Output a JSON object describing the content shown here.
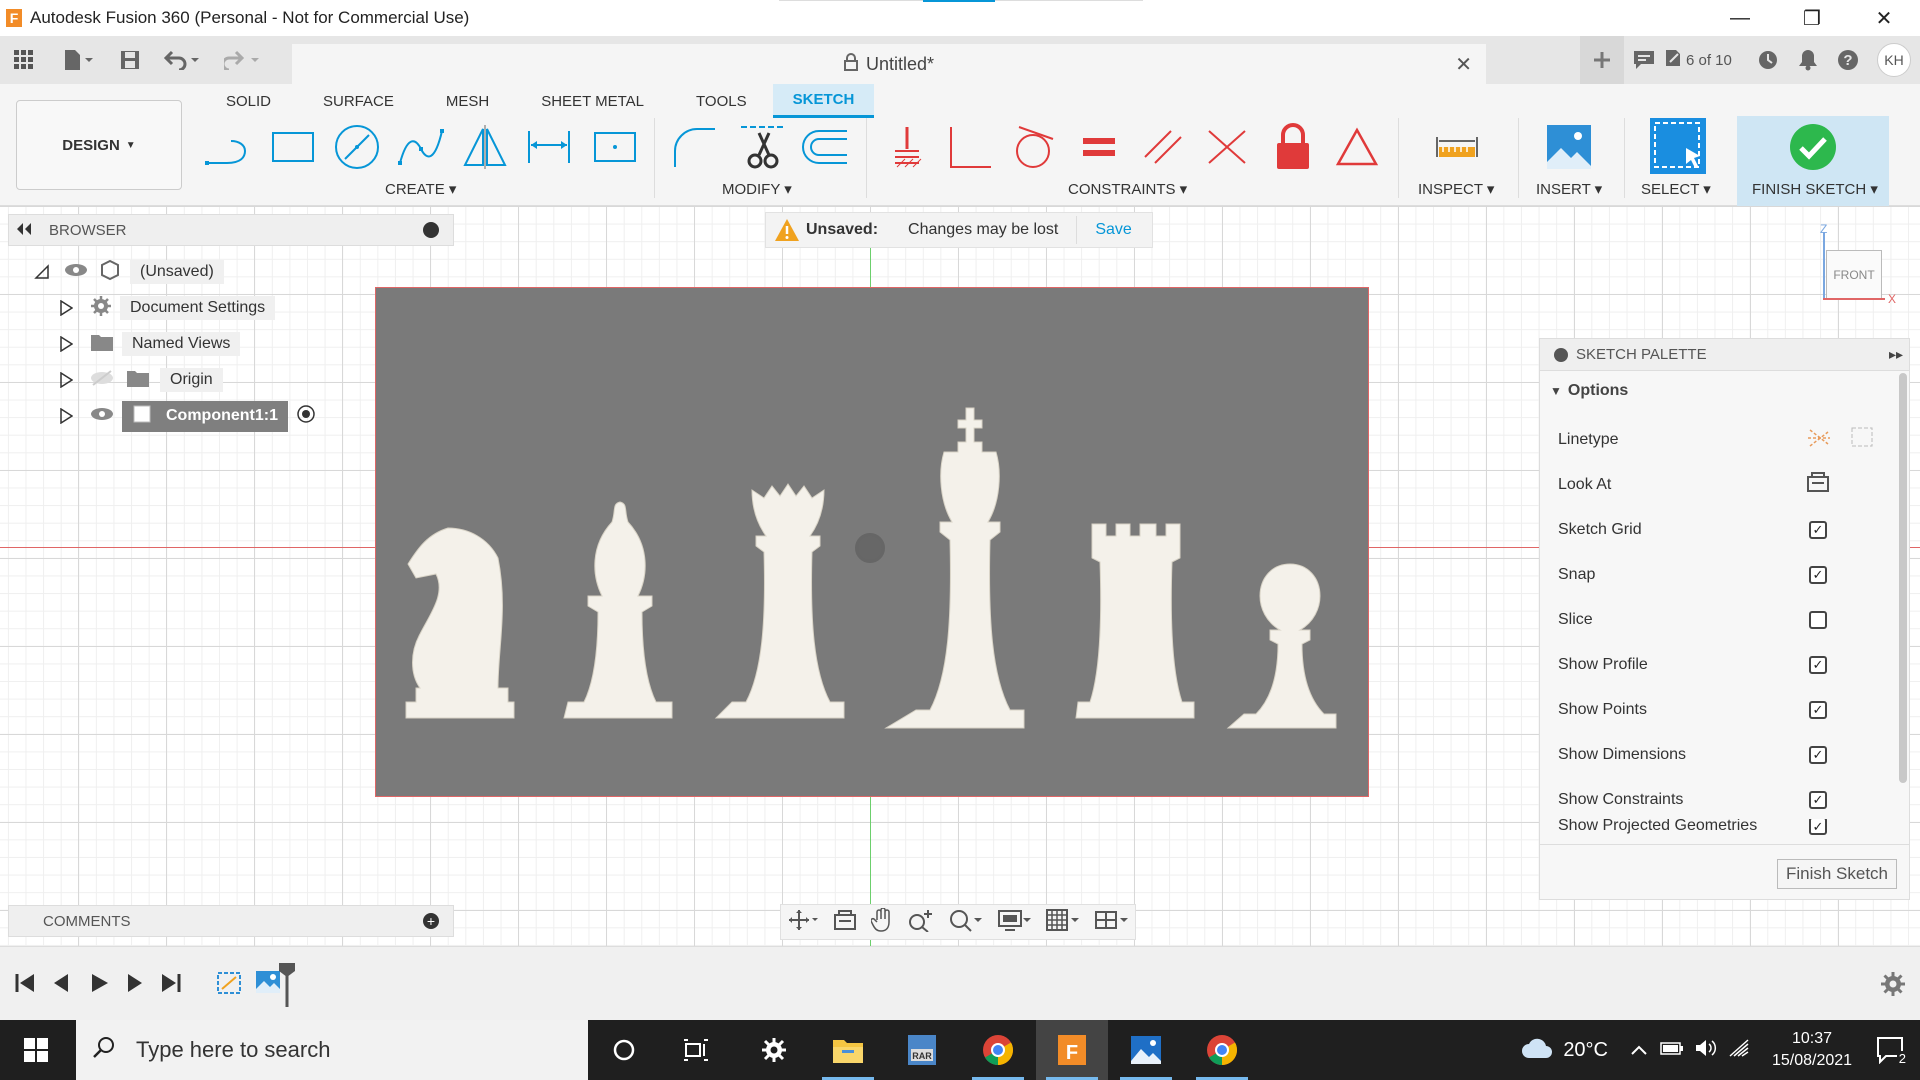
{
  "window": {
    "title": "Autodesk Fusion 360 (Personal - Not for Commercial Use)",
    "logo_letter": "F",
    "minimize": "—",
    "maximize": "❐",
    "close": "✕"
  },
  "qat": {
    "document_title": "Untitled*",
    "tab_close": "✕",
    "jobs": "6 of 10",
    "user_initials": "KH"
  },
  "ribbon": {
    "workspace": "DESIGN",
    "tabs": [
      "SOLID",
      "SURFACE",
      "MESH",
      "SHEET METAL",
      "TOOLS",
      "SKETCH"
    ],
    "active_tab": "SKETCH",
    "groups": {
      "create": "CREATE",
      "modify": "MODIFY",
      "constraints": "CONSTRAINTS",
      "inspect": "INSPECT",
      "insert": "INSERT",
      "select": "SELECT",
      "finish": "FINISH SKETCH"
    }
  },
  "notice": {
    "label": "Unsaved:",
    "message": "Changes may be lost",
    "action": "Save"
  },
  "browser": {
    "title": "BROWSER",
    "items": [
      {
        "label": "(Unsaved)"
      },
      {
        "label": "Document Settings"
      },
      {
        "label": "Named Views"
      },
      {
        "label": "Origin"
      },
      {
        "label": "Component1:1"
      }
    ]
  },
  "viewcube": {
    "face": "FRONT",
    "axis_z": "Z",
    "axis_x": "X"
  },
  "palette": {
    "title": "SKETCH PALETTE",
    "section": "Options",
    "rows": [
      {
        "label": "Linetype",
        "type": "icons"
      },
      {
        "label": "Look At",
        "type": "icon"
      },
      {
        "label": "Sketch Grid",
        "checked": true
      },
      {
        "label": "Snap",
        "checked": true
      },
      {
        "label": "Slice",
        "checked": false
      },
      {
        "label": "Show Profile",
        "checked": true
      },
      {
        "label": "Show Points",
        "checked": true
      },
      {
        "label": "Show Dimensions",
        "checked": true
      },
      {
        "label": "Show Constraints",
        "checked": true
      },
      {
        "label": "Show Projected Geometries",
        "checked": true
      }
    ],
    "finish_button": "Finish Sketch"
  },
  "comments": {
    "title": "COMMENTS"
  },
  "taskbar": {
    "search_placeholder": "Type here to search",
    "weather": "20°C",
    "time": "10:37",
    "date": "15/08/2021",
    "notifications": "2"
  },
  "colors": {
    "accent": "#0696d7",
    "finish_green": "#2db84d",
    "constraint_red": "#e03a3a",
    "photo_bg": "#7a7a7a"
  }
}
